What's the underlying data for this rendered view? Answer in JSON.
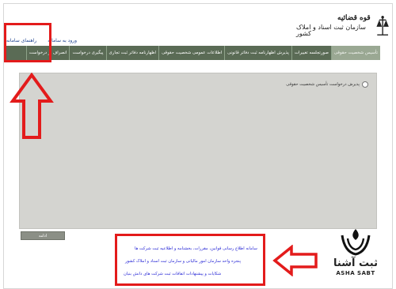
{
  "header": {
    "logo_title": "قوه قضائیه",
    "logo_subtitle": "سازمان ثبت اسناد و املاک کشور",
    "top_links": [
      "ورود به سامانه",
      "راهنمای سامانه"
    ]
  },
  "tabs": [
    {
      "label": "تأسیس شخصیت حقوقی"
    },
    {
      "label": "صورتجلسه تغییرات"
    },
    {
      "label": "پذیرش اظهارنامه ثبت دفاتر قانونی"
    },
    {
      "label": "اطلاعات عمومی شخصیت حقوقی"
    },
    {
      "label": "اظهارنامه دفاتر ثبت تجاری"
    },
    {
      "label": "پیگیری درخواست"
    },
    {
      "label": "انصراف از درخواست"
    }
  ],
  "main": {
    "radio_label": "پذیرش درخواست تأسیس شخصیت حقوقی",
    "continue_button": "ادامه"
  },
  "footer_links": [
    "سامانه اطلاع رسانی قوانین، مقررات، بخشنامه و اطلاعیه ثبت شرکت ها",
    "پنجره واحد سازمان امور مالیاتی و سازمان ثبت اسناد و املاک کشور",
    "شکایات و پیشنهادات اتفاقات ثبت شرکت های دانش بنیان"
  ],
  "brand": {
    "name_fa": "ثبت آشنا",
    "name_en": "ASHA SABT"
  },
  "colors": {
    "tab_bar": "#5a6b55",
    "tab_active": "#9aa893",
    "highlight_red": "#e31b1b",
    "link_blue": "#2a2ad6"
  }
}
